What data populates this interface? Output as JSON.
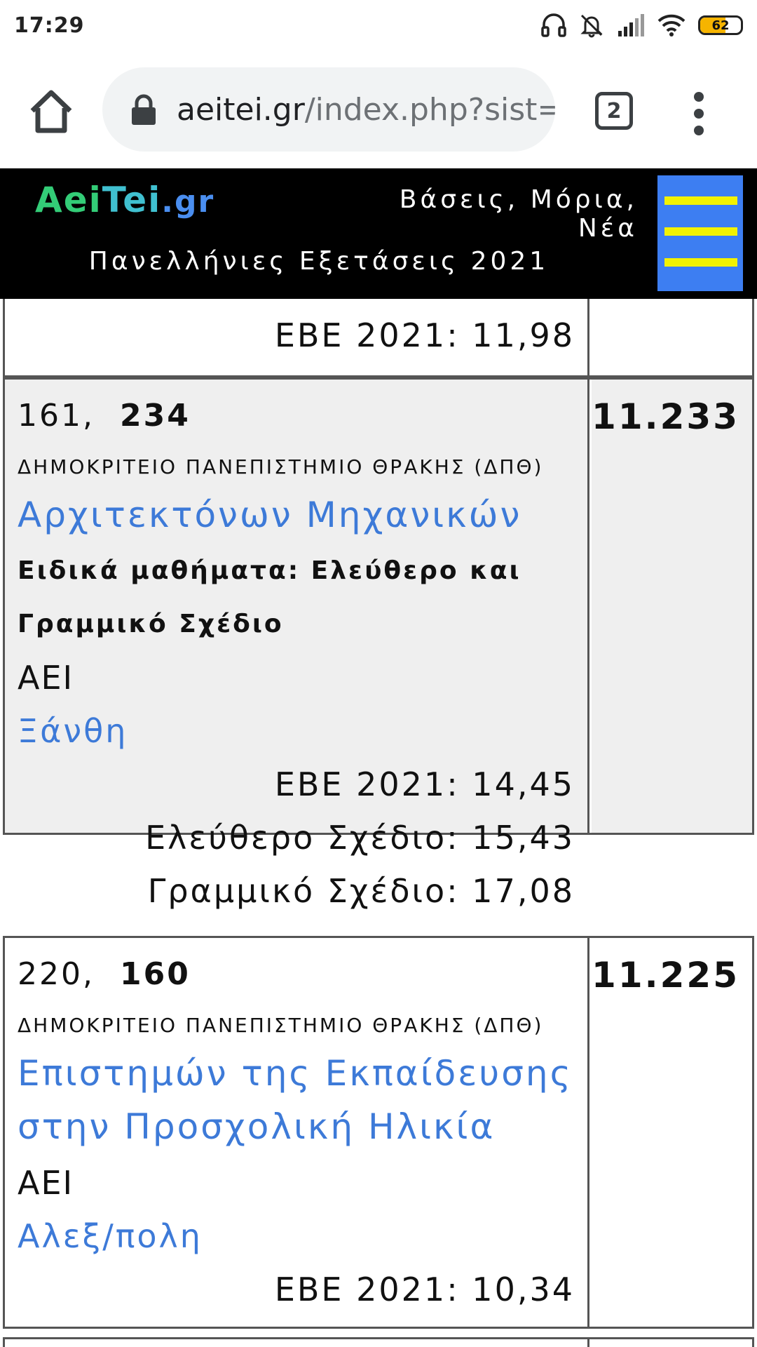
{
  "status_bar": {
    "time": "17:29",
    "battery": "62",
    "battery_level": 0.62,
    "icons": [
      "headphones-icon",
      "bell-muted-icon",
      "signal-icon",
      "wifi-icon",
      "battery-icon"
    ]
  },
  "browser": {
    "url_host": "aeitei.gr",
    "url_path": "/index.php?sist=",
    "tabs_count": "2",
    "icons": [
      "home-icon",
      "lock-icon",
      "tabs-icon",
      "more-vert-icon"
    ]
  },
  "site": {
    "logo_aei": "Aei",
    "logo_tei": "Tei",
    "logo_gr": ".gr",
    "tagline": "Βάσεις, Μόρια, Νέα",
    "subtitle": "Πανελλήνιες Εξετάσεις 2021",
    "colors": {
      "header_bg": "#000000",
      "menu_bg": "#3d7ef2",
      "menu_bars": "#f2f200",
      "link": "#3d7ad8"
    }
  },
  "rows": [
    {
      "ebe": "ΕΒΕ 2021: 11,98"
    },
    {
      "rank": "161,",
      "code": "234",
      "university": "ΔΗΜΟΚΡΙΤΕΙΟ ΠΑΝΕΠΙΣΤΗΜΙΟ ΘΡΑΚΗΣ (ΔΠΘ)",
      "department": "Αρχιτεκτόνων Μηχανικών",
      "special_line1": "Ειδικά μαθήματα: Ελεύθερο και",
      "special_line2": "Γραμμικό Σχέδιο",
      "type": "ΑΕΙ",
      "city": "Ξάνθη",
      "ebe": "ΕΒΕ 2021: 14,45",
      "free_drawing": "Ελεύθερο Σχέδιο: 15,43",
      "linear_drawing": "Γραμμικό Σχέδιο: 17,08",
      "score": "11.233"
    },
    {
      "rank": "220,",
      "code": "160",
      "university": "ΔΗΜΟΚΡΙΤΕΙΟ ΠΑΝΕΠΙΣΤΗΜΙΟ ΘΡΑΚΗΣ (ΔΠΘ)",
      "department_line1": "Επιστημών της Εκπαίδευσης",
      "department_line2": "στην Προσχολική Ηλικία",
      "type": "ΑΕΙ",
      "city": "Αλεξ/πολη",
      "ebe": "ΕΒΕ 2021: 10,34",
      "score": "11.225"
    }
  ]
}
